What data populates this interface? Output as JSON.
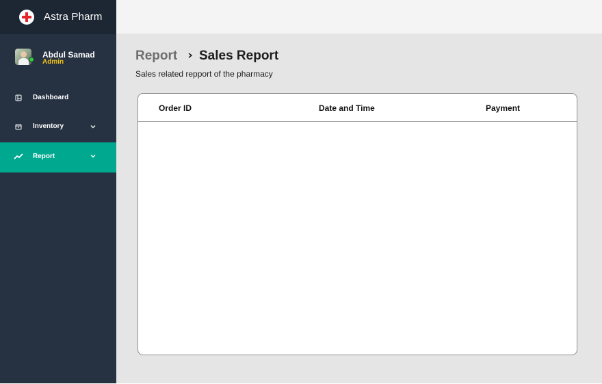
{
  "app": {
    "brand_name": "Astra Pharm"
  },
  "user": {
    "name": "Abdul Samad",
    "role": "Admin",
    "status": "online"
  },
  "sidebar": {
    "items": [
      {
        "label": "Dashboard",
        "icon": "dashboard-icon",
        "has_chevron": false,
        "active": false
      },
      {
        "label": "Inventory",
        "icon": "inventory-icon",
        "has_chevron": true,
        "active": false
      },
      {
        "label": "Report",
        "icon": "trend-line-icon",
        "has_chevron": true,
        "active": true
      }
    ]
  },
  "breadcrumb": {
    "parent": "Report",
    "separator_icon": "chevron-right-icon",
    "current": "Sales Report"
  },
  "page": {
    "subtitle": "Sales related repport of the pharmacy"
  },
  "table": {
    "columns": [
      "Order ID",
      "Date and Time",
      "Payment"
    ],
    "rows": []
  },
  "colors": {
    "sidebar_bg": "#263141",
    "brand_bg": "#1d2633",
    "active_item": "#00a88f",
    "role_yellow": "#f2c218",
    "status_green": "#2ecc40",
    "logo_cross": "#e3262b",
    "main_bg": "#e4e5e4",
    "topbar_bg": "#f4f4f4"
  }
}
